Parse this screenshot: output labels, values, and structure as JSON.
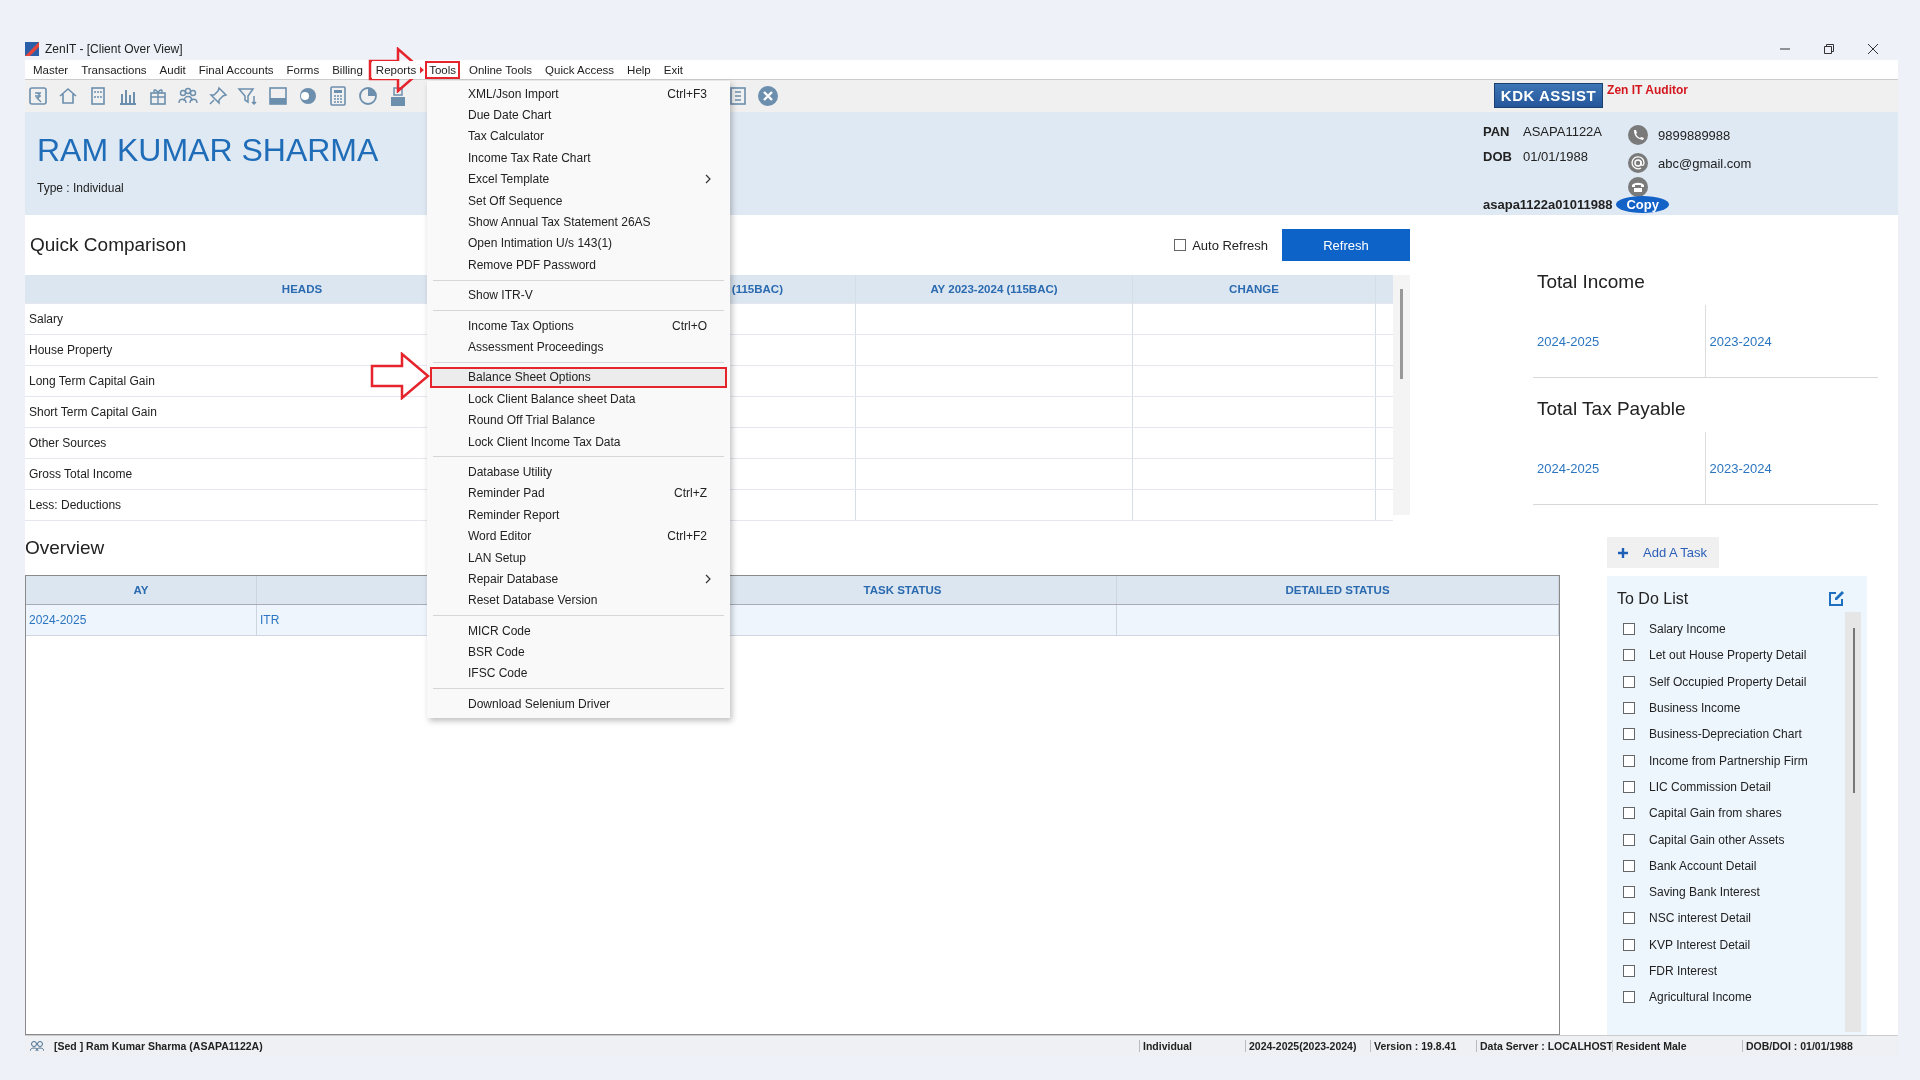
{
  "window": {
    "title": "ZenIT - [Client Over View]"
  },
  "menu_bar": [
    {
      "label": "Master",
      "selected": false
    },
    {
      "label": "Transactions",
      "selected": false
    },
    {
      "label": "Audit",
      "selected": false
    },
    {
      "label": "Final Accounts",
      "selected": false
    },
    {
      "label": "Forms",
      "selected": false
    },
    {
      "label": "Billing",
      "selected": false
    },
    {
      "label": "Reports",
      "selected": false
    },
    {
      "label": "Tools",
      "selected": true
    },
    {
      "label": "Online Tools",
      "selected": false
    },
    {
      "label": "Quick Access",
      "selected": false
    },
    {
      "label": "Help",
      "selected": false
    },
    {
      "label": "Exit",
      "selected": false
    }
  ],
  "toolbar": {
    "assist_button": "KDK ASSIST",
    "auditor_label": "Zen IT Auditor"
  },
  "client": {
    "name": "RAM KUMAR SHARMA",
    "type": "Type : Individual",
    "pan_label": "PAN",
    "pan": "ASAPA1122A",
    "dob_label": "DOB",
    "dob": "01/01/1988",
    "phone": "9899889988",
    "email": "abc@gmail.com",
    "password": "asapa1122a01011988",
    "copy_button": "Copy"
  },
  "quick_comparison": {
    "title": "Quick Comparison",
    "auto_refresh": {
      "label": "Auto Refresh",
      "checked": false
    },
    "refresh_button": "Refresh",
    "columns": [
      "HEADS",
      "(115BAC)",
      "AY 2023-2024 (115BAC)",
      "CHANGE"
    ],
    "rows": [
      "Salary",
      "House Property",
      "Long Term Capital Gain",
      "Short Term Capital Gain",
      "Other Sources",
      "Gross Total Income",
      "Less: Deductions"
    ]
  },
  "overview": {
    "title": "Overview",
    "columns": [
      {
        "label": "AY"
      },
      {
        "label": "TASK STATUS"
      },
      {
        "label": "DETAILED STATUS"
      }
    ],
    "rows": [
      {
        "ay": "2024-2025",
        "column_2": "ITR",
        "selected": true
      }
    ]
  },
  "total_income": {
    "title": "Total Income",
    "years": [
      "2024-2025",
      "2023-2024"
    ]
  },
  "total_tax_payable": {
    "title": "Total Tax Payable",
    "years": [
      "2024-2025",
      "2023-2024"
    ]
  },
  "todo": {
    "add_button": "Add A Task",
    "title": "To Do List",
    "items": [
      {
        "label": "Salary Income",
        "checked": false
      },
      {
        "label": "Let out House Property Detail",
        "checked": false
      },
      {
        "label": "Self Occupied Property Detail",
        "checked": false
      },
      {
        "label": "Business Income",
        "checked": false
      },
      {
        "label": "Business-Depreciation Chart",
        "checked": false
      },
      {
        "label": "Income from Partnership Firm",
        "checked": false
      },
      {
        "label": "LIC Commission Detail",
        "checked": false
      },
      {
        "label": "Capital Gain from shares",
        "checked": false
      },
      {
        "label": "Capital Gain other Assets",
        "checked": false
      },
      {
        "label": "Bank Account Detail",
        "checked": false
      },
      {
        "label": "Saving Bank Interest",
        "checked": false
      },
      {
        "label": "NSC interest Detail",
        "checked": false
      },
      {
        "label": "KVP Interest Detail",
        "checked": false
      },
      {
        "label": "FDR Interest",
        "checked": false
      },
      {
        "label": "Agricultural Income",
        "checked": false
      }
    ]
  },
  "tools_menu": [
    {
      "kind": "item",
      "label": "XML/Json Import",
      "shortcut": "Ctrl+F3",
      "submenu": false,
      "selected": false
    },
    {
      "kind": "item",
      "label": "Due Date Chart",
      "submenu": false,
      "selected": false
    },
    {
      "kind": "item",
      "label": "Tax Calculator",
      "submenu": false,
      "selected": false
    },
    {
      "kind": "item",
      "label": "Income Tax Rate Chart",
      "submenu": false,
      "selected": false
    },
    {
      "kind": "item",
      "label": "Excel Template",
      "submenu": true,
      "selected": false
    },
    {
      "kind": "item",
      "label": "Set Off Sequence",
      "submenu": false,
      "selected": false
    },
    {
      "kind": "item",
      "label": "Show Annual Tax Statement 26AS",
      "submenu": false,
      "selected": false
    },
    {
      "kind": "item",
      "label": "Open Intimation U/s 143(1)",
      "submenu": false,
      "selected": false
    },
    {
      "kind": "item",
      "label": "Remove PDF Password",
      "submenu": false,
      "selected": false
    },
    {
      "kind": "separator"
    },
    {
      "kind": "item",
      "label": "Show ITR-V",
      "submenu": false,
      "selected": false
    },
    {
      "kind": "separator"
    },
    {
      "kind": "item",
      "label": "Income Tax Options",
      "shortcut": "Ctrl+O",
      "submenu": false,
      "selected": false
    },
    {
      "kind": "item",
      "label": "Assessment Proceedings",
      "submenu": false,
      "selected": false
    },
    {
      "kind": "separator"
    },
    {
      "kind": "item",
      "label": "Balance Sheet Options",
      "submenu": false,
      "selected": true
    },
    {
      "kind": "item",
      "label": "Lock Client Balance sheet Data",
      "submenu": false,
      "selected": false
    },
    {
      "kind": "item",
      "label": "Round Off Trial Balance",
      "submenu": false,
      "selected": false
    },
    {
      "kind": "item",
      "label": "Lock Client Income Tax Data",
      "submenu": false,
      "selected": false
    },
    {
      "kind": "separator"
    },
    {
      "kind": "item",
      "label": "Database Utility",
      "submenu": false,
      "selected": false
    },
    {
      "kind": "item",
      "label": "Reminder Pad",
      "shortcut": "Ctrl+Z",
      "submenu": false,
      "selected": false
    },
    {
      "kind": "item",
      "label": "Reminder Report",
      "submenu": false,
      "selected": false
    },
    {
      "kind": "item",
      "label": "Word Editor",
      "shortcut": "Ctrl+F2",
      "submenu": false,
      "selected": false
    },
    {
      "kind": "item",
      "label": "LAN Setup",
      "submenu": false,
      "selected": false
    },
    {
      "kind": "item",
      "label": "Repair Database",
      "submenu": true,
      "selected": false
    },
    {
      "kind": "item",
      "label": "Reset Database Version",
      "submenu": false,
      "selected": false
    },
    {
      "kind": "separator"
    },
    {
      "kind": "item",
      "label": "MICR Code",
      "submenu": false,
      "selected": false
    },
    {
      "kind": "item",
      "label": "BSR Code",
      "submenu": false,
      "selected": false
    },
    {
      "kind": "item",
      "label": "IFSC Code",
      "submenu": false,
      "selected": false
    },
    {
      "kind": "separator"
    },
    {
      "kind": "item",
      "label": "Download Selenium Driver",
      "submenu": false,
      "selected": false
    }
  ],
  "status_bar": {
    "client": "[Sed ] Ram Kumar Sharma (ASAPA1122A)",
    "fields": [
      "Individual",
      "2024-2025(2023-2024)",
      "Version : 19.8.41",
      "Data Server : LOCALHOST",
      "Resident Male",
      "DOB/DOI : 01/01/1988"
    ]
  }
}
